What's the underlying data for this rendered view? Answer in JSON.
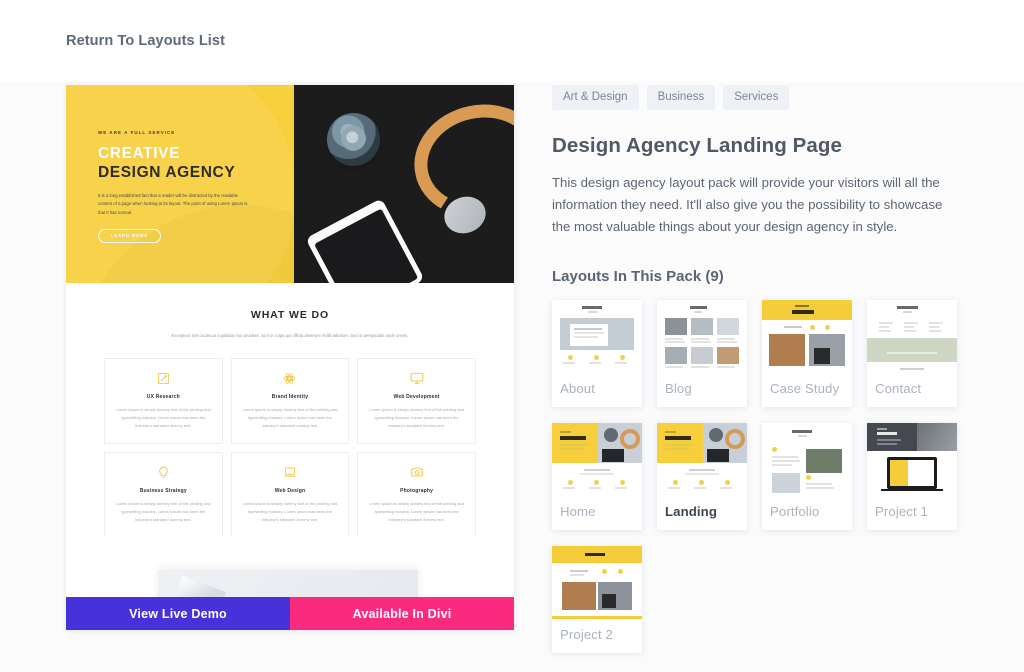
{
  "topbar": {
    "return_label": "Return To Layouts List"
  },
  "preview": {
    "hero": {
      "eyebrow": "WE ARE A FULL SERVICE",
      "title_line1": "CREATIVE",
      "title_line2": "DESIGN AGENCY",
      "paragraph": "It is a long established fact that a reader will be distracted by the readable content of a page when looking at its layout. The point of using Lorem Ipsum is that it has normal.",
      "button_label": "LEARN MORE"
    },
    "what_we_do": {
      "title": "WHAT WE DO",
      "subtitle": "Excepteur sint occaecat cupidatat non proident, sunt in culpa qui officia deserunt mollit laborum. Sed ut perspiciatis unde omnis.",
      "cards": [
        {
          "icon": "pen-tool-icon",
          "title": "UX Research",
          "body": "Lorem Ipsum is simply dummy text of the printing and typesetting industry. Lorem Ipsum has been the industry's standard dummy text."
        },
        {
          "icon": "atom-icon",
          "title": "Brand Identity",
          "body": "Lorem Ipsum is simply dummy text of the printing and typesetting industry. Lorem Ipsum has been the industry's standard dummy text."
        },
        {
          "icon": "monitor-icon",
          "title": "Web Development",
          "body": "Lorem Ipsum is simply dummy text of the printing and typesetting industry. Lorem Ipsum has been the industry's standard dummy text."
        },
        {
          "icon": "lightbulb-icon",
          "title": "Business Strategy",
          "body": "Lorem Ipsum is simply dummy text of the printing and typesetting industry. Lorem Ipsum has been the industry's standard dummy text."
        },
        {
          "icon": "laptop-icon",
          "title": "Web Design",
          "body": "Lorem Ipsum is simply dummy text of the printing and typesetting industry. Lorem Ipsum has been the industry's standard dummy text."
        },
        {
          "icon": "camera-icon",
          "title": "Photography",
          "body": "Lorem Ipsum is simply dummy text of the printing and typesetting industry. Lorem Ipsum has been the industry's standard dummy text."
        }
      ]
    }
  },
  "cta": {
    "view_demo_label": "View Live Demo",
    "available_in_divi_label": "Available In Divi",
    "view_demo_color": "#4632d8",
    "available_in_divi_color": "#fa2a7f"
  },
  "details": {
    "tags": [
      "Art & Design",
      "Business",
      "Services"
    ],
    "title": "Design Agency Landing Page",
    "description": "This design agency layout pack will provide your visitors will all the information they need. It'll also give you the possibility to showcase the most valuable things about your design agency in style.",
    "layouts_heading": "Layouts In This Pack (9)",
    "layouts": [
      {
        "label": "About",
        "active": false,
        "style": "about"
      },
      {
        "label": "Blog",
        "active": false,
        "style": "blog"
      },
      {
        "label": "Case Study",
        "active": false,
        "style": "case-study"
      },
      {
        "label": "Contact",
        "active": false,
        "style": "contact"
      },
      {
        "label": "Home",
        "active": false,
        "style": "home"
      },
      {
        "label": "Landing",
        "active": true,
        "style": "landing"
      },
      {
        "label": "Portfolio",
        "active": false,
        "style": "portfolio"
      },
      {
        "label": "Project 1",
        "active": false,
        "style": "project1"
      },
      {
        "label": "Project 2",
        "active": false,
        "style": "project2"
      }
    ]
  },
  "theme": {
    "accent_yellow": "#f7cf3d",
    "tag_bg": "#eef1f6",
    "text_muted": "#aab3bd",
    "page_bg": "#fbfbfc"
  }
}
